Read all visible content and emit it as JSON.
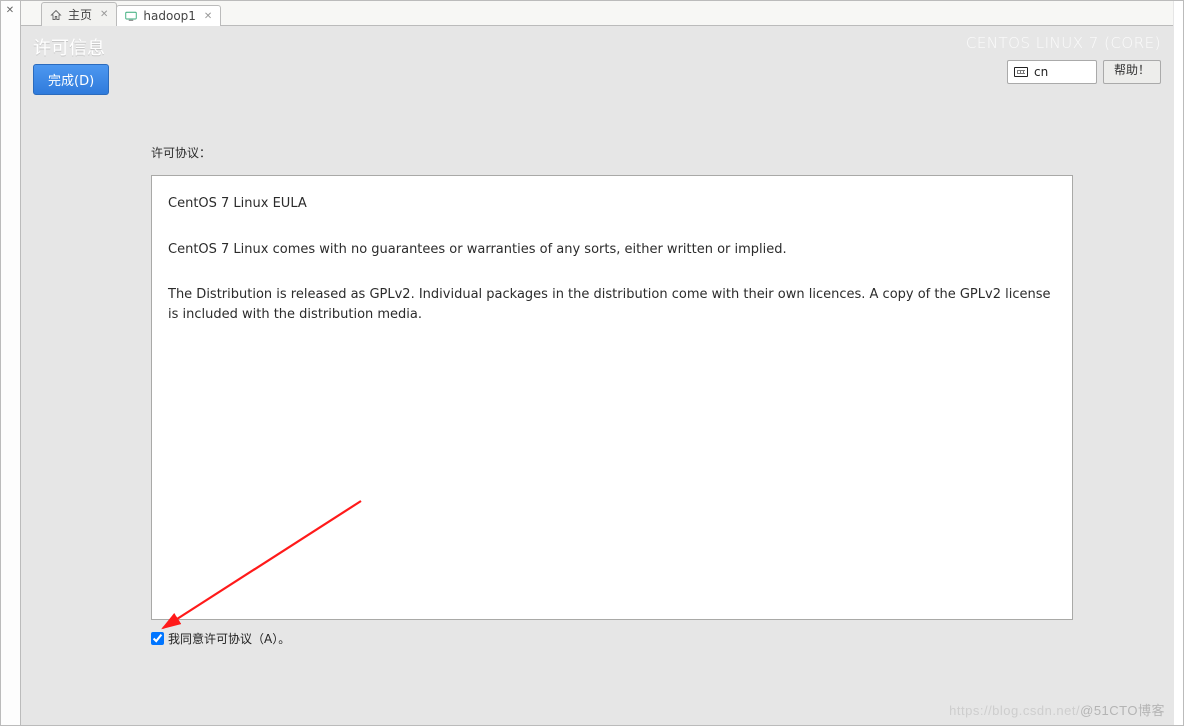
{
  "tabs": {
    "home": {
      "label": "主页"
    },
    "hadoop": {
      "label": "hadoop1"
    }
  },
  "header": {
    "title": "许可信息",
    "done_label": "完成(D)",
    "os_label": "CENTOS LINUX 7 (CORE)",
    "lang_code": "cn",
    "help_label": "帮助！"
  },
  "license": {
    "section_label": "许可协议：",
    "eula_title": "CentOS 7 Linux EULA",
    "line1": "CentOS 7 Linux comes with no guarantees or warranties of any sorts, either written or implied.",
    "line2": "The Distribution is released as GPLv2. Individual packages in the distribution come with their own licences. A copy of the GPLv2 license is included with the distribution media.",
    "agree_checked": true,
    "agree_label": "我同意许可协议（A）。"
  },
  "watermark": {
    "faint": "https://blog.csdn.net/",
    "text": "@51CTO博客"
  }
}
